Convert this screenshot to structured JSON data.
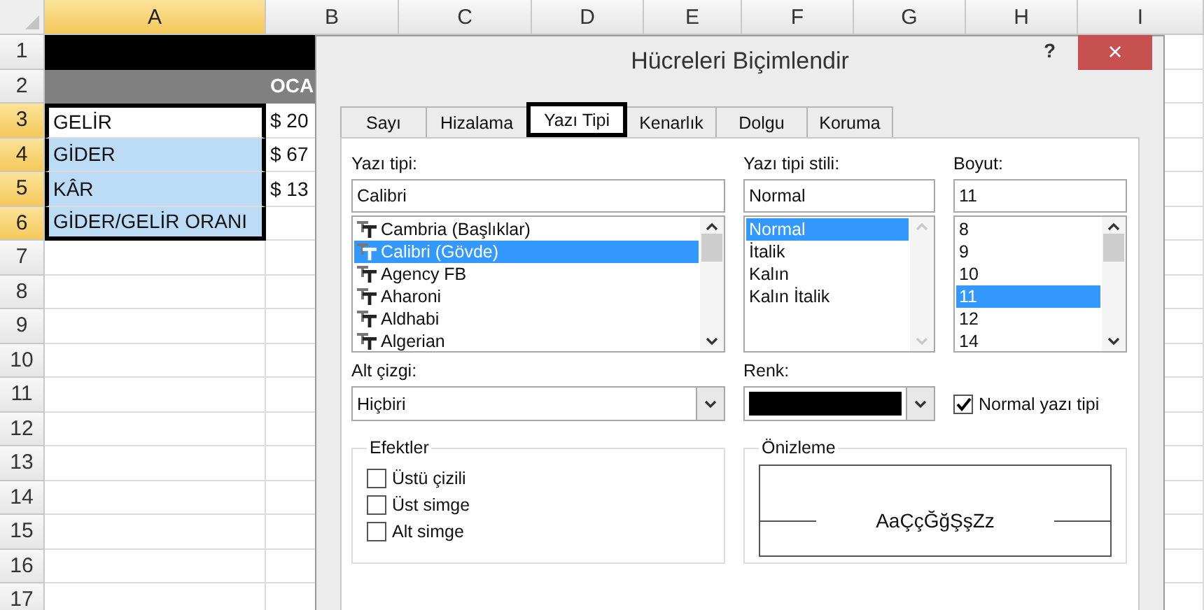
{
  "sheet": {
    "columns": [
      {
        "label": "A",
        "selected": true
      },
      {
        "label": "B",
        "selected": false
      },
      {
        "label": "C",
        "selected": false
      },
      {
        "label": "D",
        "selected": false
      },
      {
        "label": "E",
        "selected": false
      },
      {
        "label": "F",
        "selected": false
      },
      {
        "label": "G",
        "selected": false
      },
      {
        "label": "H",
        "selected": false
      },
      {
        "label": "I",
        "selected": false
      }
    ],
    "rows": [
      {
        "label": "1",
        "selected": false,
        "cells": [
          {
            "kind": "banner"
          },
          {
            "kind": "banner"
          }
        ]
      },
      {
        "label": "2",
        "selected": false,
        "cells": [
          {
            "kind": "header"
          },
          {
            "kind": "header",
            "text": "OCA"
          }
        ]
      },
      {
        "label": "3",
        "selected": true,
        "cells": [
          {
            "kind": "plain",
            "text": "GELİR",
            "selected": true
          },
          {
            "kind": "plain",
            "text": "$ 20"
          }
        ]
      },
      {
        "label": "4",
        "selected": true,
        "cells": [
          {
            "kind": "highlight",
            "text": "GİDER",
            "selected": true
          },
          {
            "kind": "plain",
            "text": "$ 67"
          }
        ]
      },
      {
        "label": "5",
        "selected": true,
        "cells": [
          {
            "kind": "highlight",
            "text": "KÂR",
            "selected": true
          },
          {
            "kind": "plain",
            "text": "$ 13"
          }
        ]
      },
      {
        "label": "6",
        "selected": true,
        "cells": [
          {
            "kind": "highlight",
            "text": "GİDER/GELİR ORANI",
            "selected": true
          }
        ]
      },
      {
        "label": "7",
        "selected": false
      },
      {
        "label": "8",
        "selected": false
      },
      {
        "label": "9",
        "selected": false
      },
      {
        "label": "10",
        "selected": false
      },
      {
        "label": "11",
        "selected": false
      },
      {
        "label": "12",
        "selected": false
      },
      {
        "label": "13",
        "selected": false
      },
      {
        "label": "14",
        "selected": false
      },
      {
        "label": "15",
        "selected": false
      },
      {
        "label": "16",
        "selected": false
      },
      {
        "label": "17",
        "selected": false
      }
    ]
  },
  "dialog": {
    "title": "Hücreleri Biçimlendir",
    "help": "?",
    "close": "×",
    "tabs": [
      {
        "label": "Sayı",
        "selected": false
      },
      {
        "label": "Hizalama",
        "selected": false
      },
      {
        "label": "Yazı Tipi",
        "selected": true
      },
      {
        "label": "Kenarlık",
        "selected": false
      },
      {
        "label": "Dolgu",
        "selected": false
      },
      {
        "label": "Koruma",
        "selected": false
      }
    ],
    "font": {
      "label": "Yazı tipi:",
      "value": "Calibri",
      "scrollable": true,
      "items": [
        {
          "label": "Cambria (Başlıklar)",
          "selected": false
        },
        {
          "label": "Calibri (Gövde)",
          "selected": true
        },
        {
          "label": "Agency FB",
          "selected": false
        },
        {
          "label": "Aharoni",
          "selected": false
        },
        {
          "label": "Aldhabi",
          "selected": false
        },
        {
          "label": "Algerian",
          "selected": false
        }
      ]
    },
    "style": {
      "label": "Yazı tipi stili:",
      "value": "Normal",
      "scrollable": false,
      "items": [
        {
          "label": "Normal",
          "selected": true
        },
        {
          "label": "İtalik",
          "selected": false
        },
        {
          "label": "Kalın",
          "selected": false
        },
        {
          "label": "Kalın İtalik",
          "selected": false
        }
      ]
    },
    "size": {
      "label": "Boyut:",
      "value": "11",
      "scrollable": true,
      "items": [
        {
          "label": "8",
          "selected": false
        },
        {
          "label": "9",
          "selected": false
        },
        {
          "label": "10",
          "selected": false
        },
        {
          "label": "11",
          "selected": true
        },
        {
          "label": "12",
          "selected": false
        },
        {
          "label": "14",
          "selected": false
        }
      ]
    },
    "underline": {
      "label": "Alt çizgi:",
      "value": "Hiçbiri"
    },
    "font_color": {
      "label": "Renk:",
      "color": "#000000"
    },
    "normal_font": {
      "label": "Normal yazı tipi",
      "checked": true
    },
    "effects": {
      "title": "Efektler",
      "options": [
        {
          "label": "Üstü çizili",
          "checked": false
        },
        {
          "label": "Üst simge",
          "checked": false
        },
        {
          "label": "Alt simge",
          "checked": false
        }
      ]
    },
    "preview": {
      "title": "Önizleme",
      "sample": "AaÇçĞğŞşZz"
    }
  }
}
